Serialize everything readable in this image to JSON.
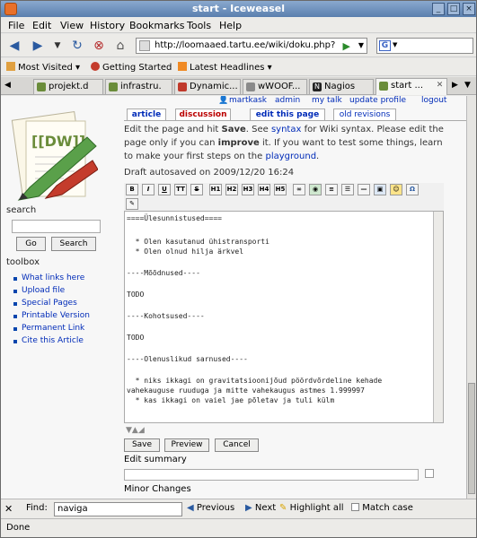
{
  "window": {
    "title": "start - Iceweasel"
  },
  "menu": [
    "File",
    "Edit",
    "View",
    "History",
    "Bookmarks",
    "Tools",
    "Help"
  ],
  "nav": {
    "url": "http://loomaaed.tartu.ee/wiki/doku.php?",
    "search_engine": "G"
  },
  "bookmarks": [
    "Most Visited",
    "Getting Started",
    "Latest Headlines"
  ],
  "tabs": [
    "projekt.d",
    "infrastru.",
    "Dynamic...",
    "wWOOF...",
    "Nagios",
    "start ..."
  ],
  "personal": [
    "martkask",
    "admin",
    "my talk",
    "update profile",
    "logout"
  ],
  "page_tabs": {
    "article": "article",
    "discussion": "discussion",
    "edit": "edit this page",
    "old_revisions": "old revisions"
  },
  "notice": {
    "line1_a": "Edit the page and hit ",
    "save_word": "Save",
    "line1_b": ". See ",
    "syntax_link": "syntax",
    "line1_c": " for Wiki syntax. Please edit the",
    "line2_a": "page only if you can ",
    "improve_word": "improve",
    "line2_b": " it. If you want to test some things, learn",
    "line3_a": "to make your first steps on the ",
    "playground_link": "playground",
    "line3_b": "."
  },
  "draft": "Draft autosaved on 2009/12/20 16:24",
  "toolbar_icons": [
    "bold-icon",
    "italic-icon",
    "underline-icon",
    "code-icon",
    "strikethrough-icon",
    "h1-icon",
    "h2-icon",
    "h3-icon",
    "h4-icon",
    "h5-icon",
    "link-icon",
    "external-link-icon",
    "ordered-list-icon",
    "unordered-list-icon",
    "hr-icon",
    "image-icon",
    "smiley-icon",
    "special-char-icon",
    "signature-icon"
  ],
  "toolbar_labels": [
    "B",
    "I",
    "U",
    "TT",
    "S",
    "H1",
    "H2",
    "H3",
    "H4",
    "H5",
    "",
    "",
    "",
    "",
    "",
    "",
    "",
    "Ω",
    ""
  ],
  "editor_lines": [
    "====Ülesunnistused====",
    "",
    "  * Olen kasutanud ühistransporti",
    "  * Olen olnud hilja ärkvel",
    "",
    "----Mõõdnused----",
    "",
    "TODO",
    "",
    "----Kohotsused----",
    "",
    "TODO",
    "",
    "----Olenuslikud sarnused----",
    "",
    "  * niks ikkagi on gravitatsioonijõud pöördvõrdeline kehade",
    "vahekauguse ruuduga ja mitte vahekaugus astmes 1.999997",
    "  * kas ikkagi on vaiel jae põletav ja tuli külm"
  ],
  "form": {
    "save": "Save",
    "preview": "Preview",
    "cancel": "Cancel",
    "summary_label": "Edit summary",
    "minor_label": "Minor Changes"
  },
  "sidebar": {
    "search_label": "search",
    "go": "Go",
    "search_btn": "Search",
    "toolbox_label": "toolbox",
    "toolbox": [
      "What links here",
      "Upload file",
      "Special Pages",
      "Printable Version",
      "Permanent Link",
      "Cite this Article"
    ]
  },
  "find": {
    "label": "Find:",
    "value": "naviga",
    "previous": "Previous",
    "next": "Next",
    "highlight": "Highlight all",
    "match_case": "Match case"
  },
  "status": "Done",
  "colors": {
    "link": "#002bb8",
    "titlebar": "#6f91bd",
    "logo_green": "#5aa04a",
    "logo_red": "#c43c2c"
  }
}
